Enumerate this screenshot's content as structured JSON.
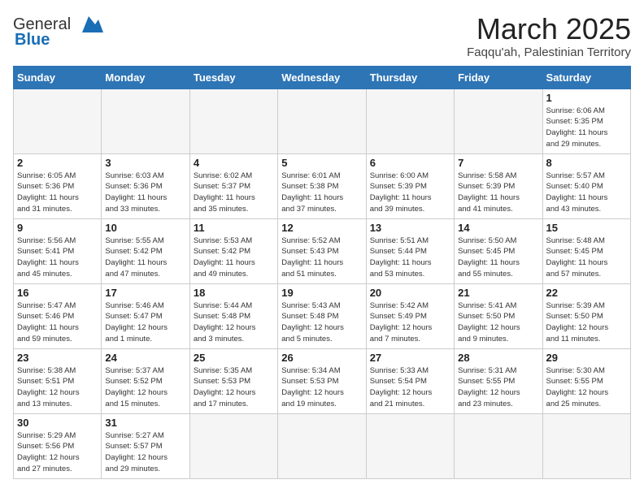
{
  "header": {
    "logo_general": "General",
    "logo_blue": "Blue",
    "month_title": "March 2025",
    "subtitle": "Faqqu'ah, Palestinian Territory"
  },
  "days_of_week": [
    "Sunday",
    "Monday",
    "Tuesday",
    "Wednesday",
    "Thursday",
    "Friday",
    "Saturday"
  ],
  "weeks": [
    [
      {
        "day": "",
        "info": "",
        "empty": true
      },
      {
        "day": "",
        "info": "",
        "empty": true
      },
      {
        "day": "",
        "info": "",
        "empty": true
      },
      {
        "day": "",
        "info": "",
        "empty": true
      },
      {
        "day": "",
        "info": "",
        "empty": true
      },
      {
        "day": "",
        "info": "",
        "empty": true
      },
      {
        "day": "1",
        "info": "Sunrise: 6:06 AM\nSunset: 5:35 PM\nDaylight: 11 hours\nand 29 minutes."
      }
    ],
    [
      {
        "day": "2",
        "info": "Sunrise: 6:05 AM\nSunset: 5:36 PM\nDaylight: 11 hours\nand 31 minutes."
      },
      {
        "day": "3",
        "info": "Sunrise: 6:03 AM\nSunset: 5:36 PM\nDaylight: 11 hours\nand 33 minutes."
      },
      {
        "day": "4",
        "info": "Sunrise: 6:02 AM\nSunset: 5:37 PM\nDaylight: 11 hours\nand 35 minutes."
      },
      {
        "day": "5",
        "info": "Sunrise: 6:01 AM\nSunset: 5:38 PM\nDaylight: 11 hours\nand 37 minutes."
      },
      {
        "day": "6",
        "info": "Sunrise: 6:00 AM\nSunset: 5:39 PM\nDaylight: 11 hours\nand 39 minutes."
      },
      {
        "day": "7",
        "info": "Sunrise: 5:58 AM\nSunset: 5:39 PM\nDaylight: 11 hours\nand 41 minutes."
      },
      {
        "day": "8",
        "info": "Sunrise: 5:57 AM\nSunset: 5:40 PM\nDaylight: 11 hours\nand 43 minutes."
      }
    ],
    [
      {
        "day": "9",
        "info": "Sunrise: 5:56 AM\nSunset: 5:41 PM\nDaylight: 11 hours\nand 45 minutes."
      },
      {
        "day": "10",
        "info": "Sunrise: 5:55 AM\nSunset: 5:42 PM\nDaylight: 11 hours\nand 47 minutes."
      },
      {
        "day": "11",
        "info": "Sunrise: 5:53 AM\nSunset: 5:42 PM\nDaylight: 11 hours\nand 49 minutes."
      },
      {
        "day": "12",
        "info": "Sunrise: 5:52 AM\nSunset: 5:43 PM\nDaylight: 11 hours\nand 51 minutes."
      },
      {
        "day": "13",
        "info": "Sunrise: 5:51 AM\nSunset: 5:44 PM\nDaylight: 11 hours\nand 53 minutes."
      },
      {
        "day": "14",
        "info": "Sunrise: 5:50 AM\nSunset: 5:45 PM\nDaylight: 11 hours\nand 55 minutes."
      },
      {
        "day": "15",
        "info": "Sunrise: 5:48 AM\nSunset: 5:45 PM\nDaylight: 11 hours\nand 57 minutes."
      }
    ],
    [
      {
        "day": "16",
        "info": "Sunrise: 5:47 AM\nSunset: 5:46 PM\nDaylight: 11 hours\nand 59 minutes."
      },
      {
        "day": "17",
        "info": "Sunrise: 5:46 AM\nSunset: 5:47 PM\nDaylight: 12 hours\nand 1 minute."
      },
      {
        "day": "18",
        "info": "Sunrise: 5:44 AM\nSunset: 5:48 PM\nDaylight: 12 hours\nand 3 minutes."
      },
      {
        "day": "19",
        "info": "Sunrise: 5:43 AM\nSunset: 5:48 PM\nDaylight: 12 hours\nand 5 minutes."
      },
      {
        "day": "20",
        "info": "Sunrise: 5:42 AM\nSunset: 5:49 PM\nDaylight: 12 hours\nand 7 minutes."
      },
      {
        "day": "21",
        "info": "Sunrise: 5:41 AM\nSunset: 5:50 PM\nDaylight: 12 hours\nand 9 minutes."
      },
      {
        "day": "22",
        "info": "Sunrise: 5:39 AM\nSunset: 5:50 PM\nDaylight: 12 hours\nand 11 minutes."
      }
    ],
    [
      {
        "day": "23",
        "info": "Sunrise: 5:38 AM\nSunset: 5:51 PM\nDaylight: 12 hours\nand 13 minutes."
      },
      {
        "day": "24",
        "info": "Sunrise: 5:37 AM\nSunset: 5:52 PM\nDaylight: 12 hours\nand 15 minutes."
      },
      {
        "day": "25",
        "info": "Sunrise: 5:35 AM\nSunset: 5:53 PM\nDaylight: 12 hours\nand 17 minutes."
      },
      {
        "day": "26",
        "info": "Sunrise: 5:34 AM\nSunset: 5:53 PM\nDaylight: 12 hours\nand 19 minutes."
      },
      {
        "day": "27",
        "info": "Sunrise: 5:33 AM\nSunset: 5:54 PM\nDaylight: 12 hours\nand 21 minutes."
      },
      {
        "day": "28",
        "info": "Sunrise: 5:31 AM\nSunset: 5:55 PM\nDaylight: 12 hours\nand 23 minutes."
      },
      {
        "day": "29",
        "info": "Sunrise: 5:30 AM\nSunset: 5:55 PM\nDaylight: 12 hours\nand 25 minutes."
      }
    ],
    [
      {
        "day": "30",
        "info": "Sunrise: 5:29 AM\nSunset: 5:56 PM\nDaylight: 12 hours\nand 27 minutes."
      },
      {
        "day": "31",
        "info": "Sunrise: 5:27 AM\nSunset: 5:57 PM\nDaylight: 12 hours\nand 29 minutes."
      },
      {
        "day": "",
        "info": "",
        "empty": true
      },
      {
        "day": "",
        "info": "",
        "empty": true
      },
      {
        "day": "",
        "info": "",
        "empty": true
      },
      {
        "day": "",
        "info": "",
        "empty": true
      },
      {
        "day": "",
        "info": "",
        "empty": true
      }
    ]
  ]
}
